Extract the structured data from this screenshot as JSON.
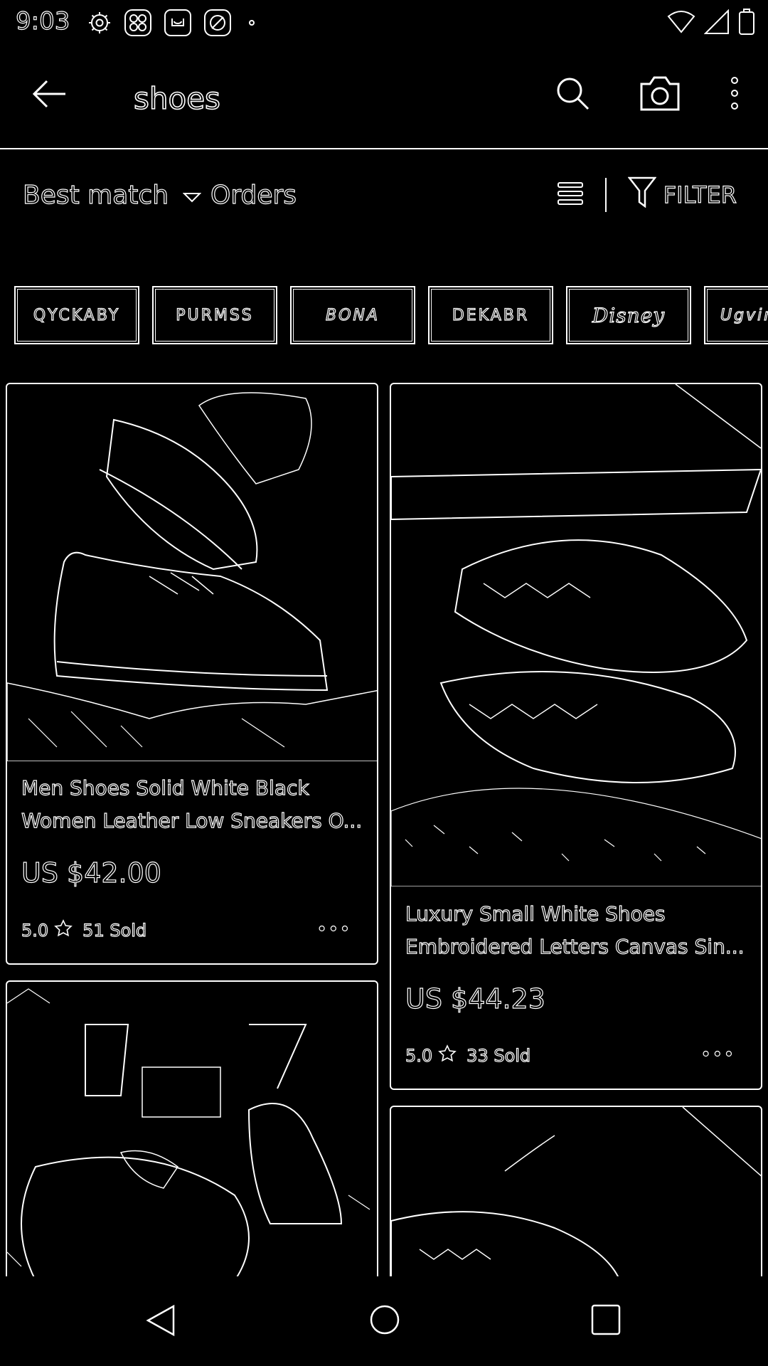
{
  "status": {
    "time": "9:03",
    "left_icons": [
      "gear-icon",
      "clover-icon",
      "bag-icon",
      "sync-icon",
      "dot-icon"
    ],
    "right_icons": [
      "wifi-icon",
      "signal-icon",
      "battery-icon"
    ]
  },
  "header": {
    "query": "shoes",
    "icons": [
      "back-arrow-icon",
      "search-icon",
      "camera-icon",
      "more-vert-icon"
    ]
  },
  "sortbar": {
    "best_match": "Best match",
    "orders": "Orders",
    "filter": "FILTER"
  },
  "brands": [
    "QYCKABY",
    "PURMSS",
    "BONA",
    "DEKABR",
    "Disney",
    "Ugvins"
  ],
  "products": [
    {
      "title_line1": "Men Shoes Solid White Black",
      "title_line2": "Women Leather Low Sneakers O...",
      "price": "US $42.00",
      "rating": "5.0",
      "sold": "51 Sold",
      "more": "•••"
    },
    {
      "title_line1": "Luxury Small White Shoes",
      "title_line2": "Embroidered Letters Canvas Sin...",
      "price": "US $44.23",
      "rating": "5.0",
      "sold": "33 Sold",
      "more": "•••"
    }
  ],
  "navbar": {
    "icons": [
      "nav-back-icon",
      "nav-home-icon",
      "nav-recents-icon"
    ]
  }
}
